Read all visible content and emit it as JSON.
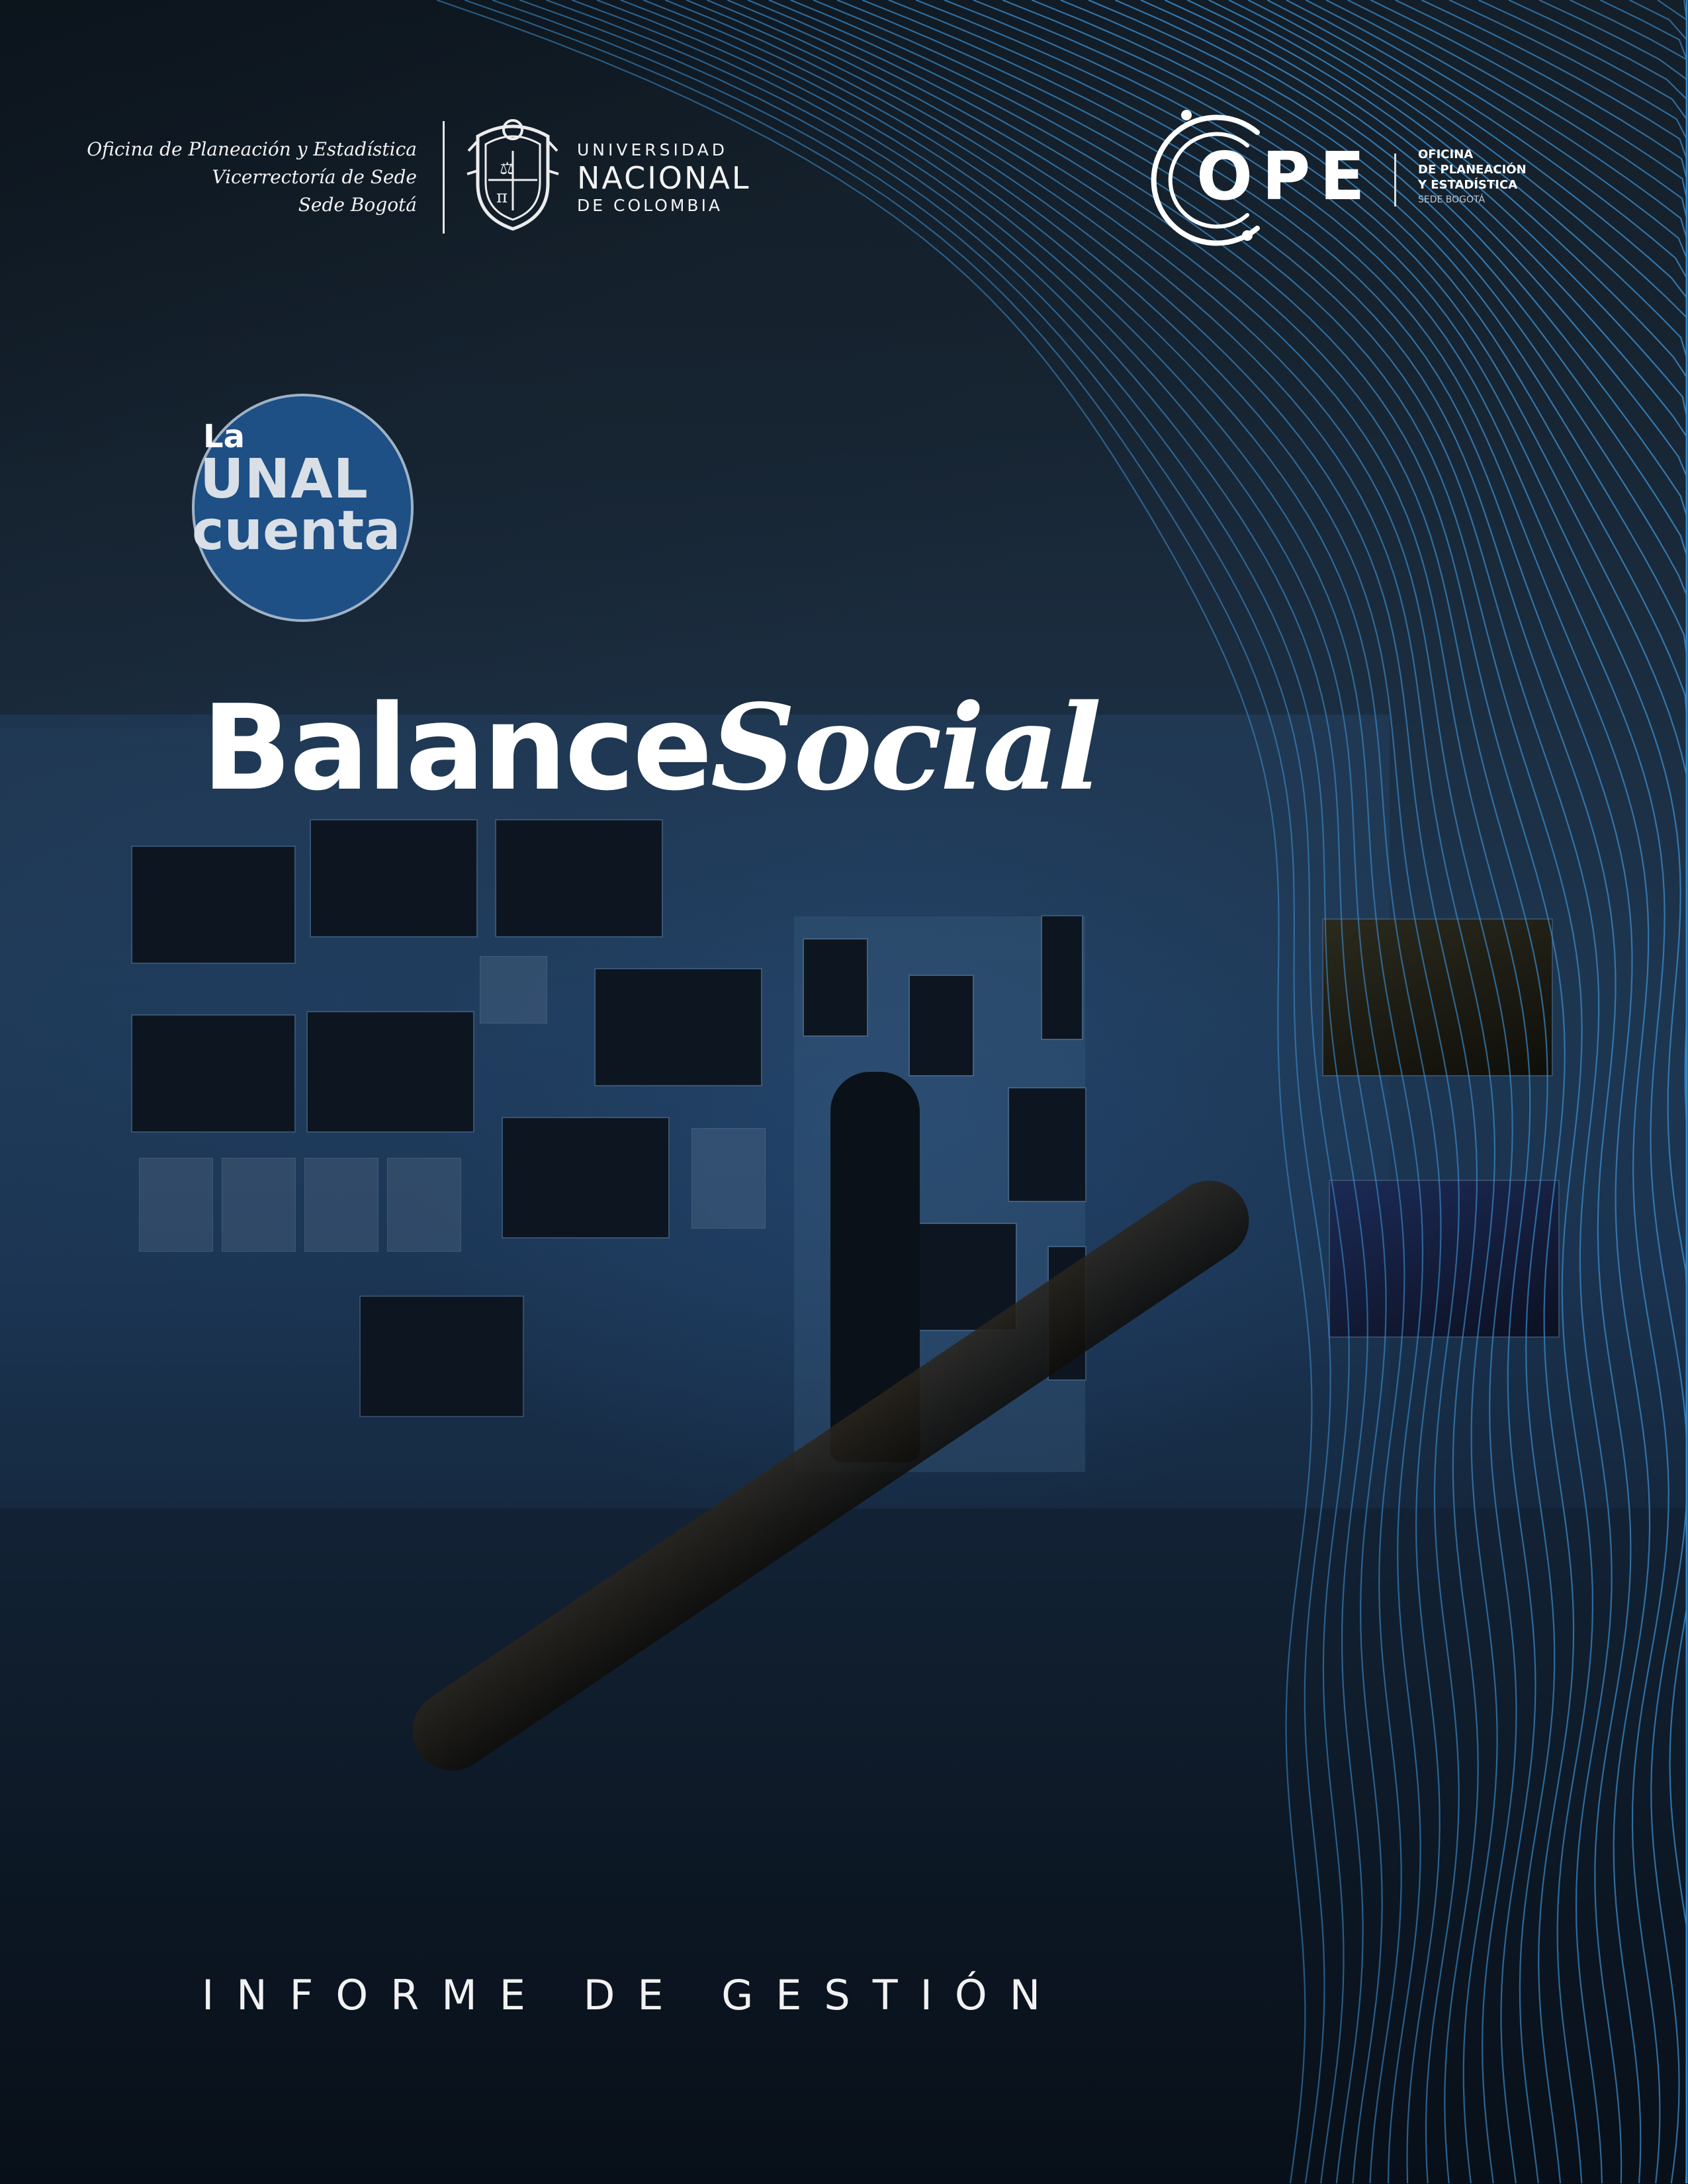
{
  "header": {
    "office_lines": [
      "Oficina de Planeación y Estadística",
      "Vicerrectoría de Sede",
      "Sede Bogotá"
    ],
    "university": {
      "line1": "UNIVERSIDAD",
      "line2": "NACIONAL",
      "line3": "DE COLOMBIA",
      "shield_icon": "university-shield-icon"
    },
    "ope": {
      "acronym": "OPE",
      "lines": [
        "OFICINA",
        "DE PLANEACIÓN",
        "Y ESTADÍSTICA"
      ],
      "small": "SEDE BOGOTÁ",
      "mark_icon": "ope-circle-mark-icon"
    }
  },
  "badge": {
    "la": "La",
    "unal": "UNAL",
    "cuenta": "cuenta",
    "color": "#1e4f85"
  },
  "title": {
    "bold": "Balance",
    "italic": "Social"
  },
  "subtitle": "INFORME DE GESTIÓN",
  "colors": {
    "wave_lines": "#3c8fd0",
    "background": "#16283c"
  }
}
